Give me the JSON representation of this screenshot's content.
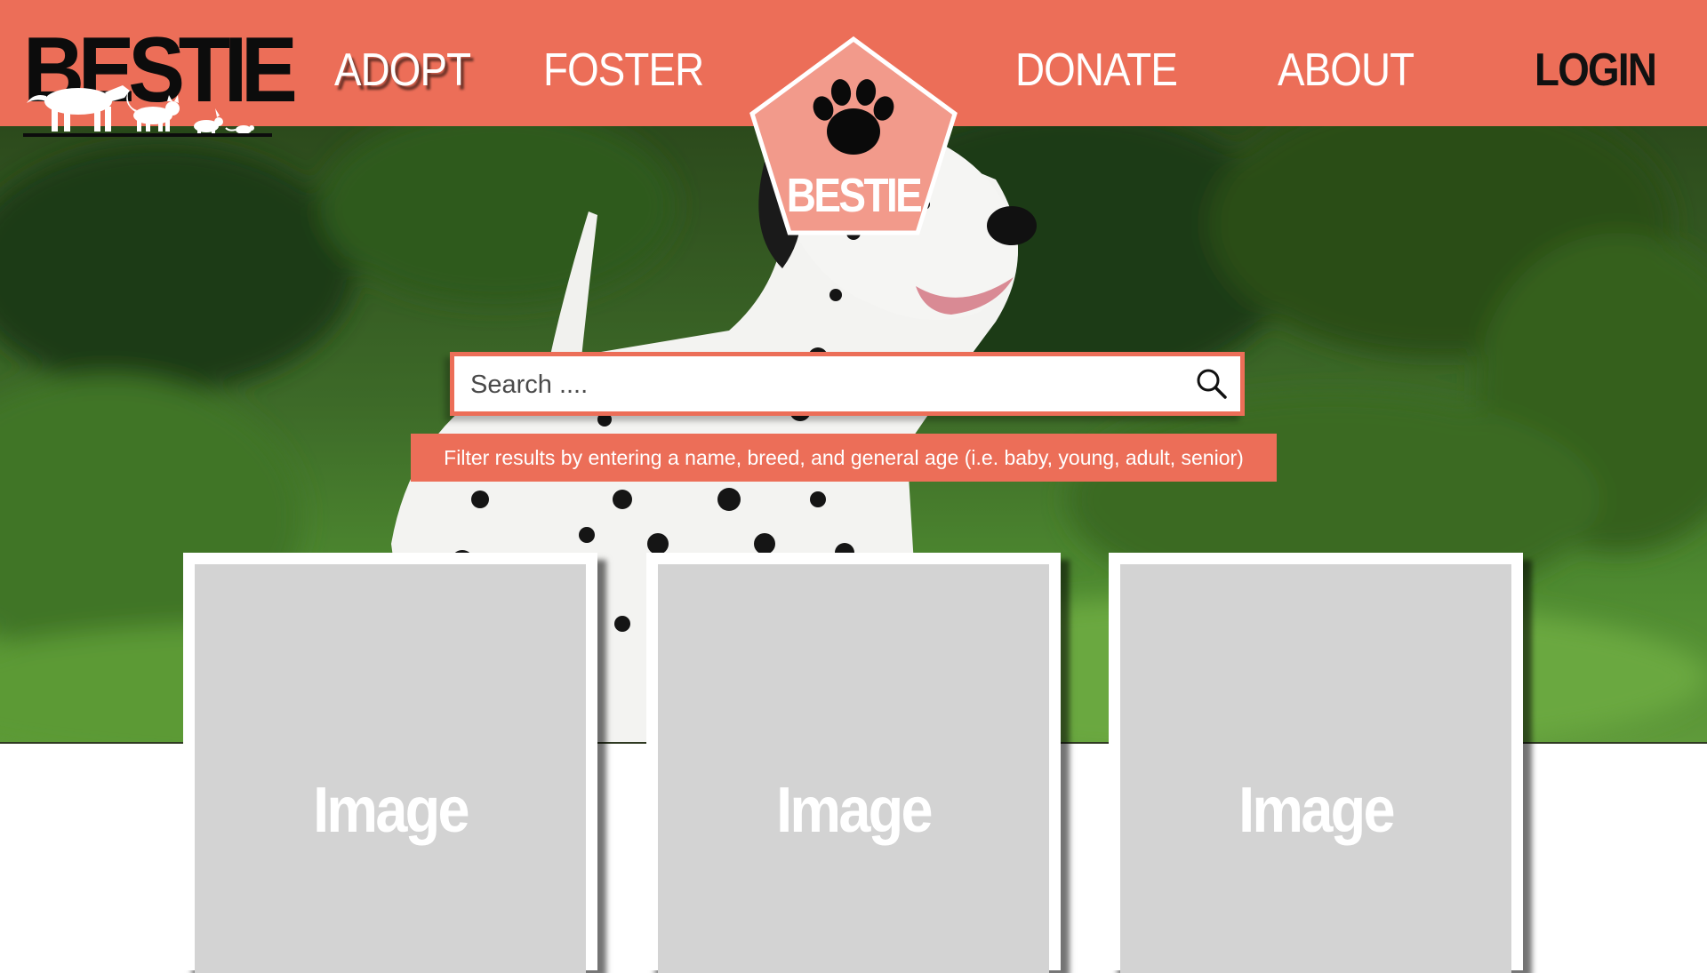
{
  "header": {
    "logo_text": "BESTIE",
    "nav": {
      "adopt": "ADOPT",
      "foster": "FOSTER",
      "donate": "DONATE",
      "about": "ABOUT",
      "login": "LOGIN"
    },
    "badge_text": "BESTIE",
    "badge_icon": "paw-print-icon"
  },
  "hero": {
    "search": {
      "placeholder": "Search ....",
      "icon": "search-icon"
    },
    "hint": "Filter results by entering a name, breed, and general age (i.e. baby, young, adult, senior)"
  },
  "cards": [
    {
      "label": "Image"
    },
    {
      "label": "Image"
    },
    {
      "label": "Image"
    }
  ],
  "colors": {
    "brand": "#ec6e58",
    "badge_fill": "#f29a8b",
    "placeholder_gray": "#d3d3d3"
  }
}
